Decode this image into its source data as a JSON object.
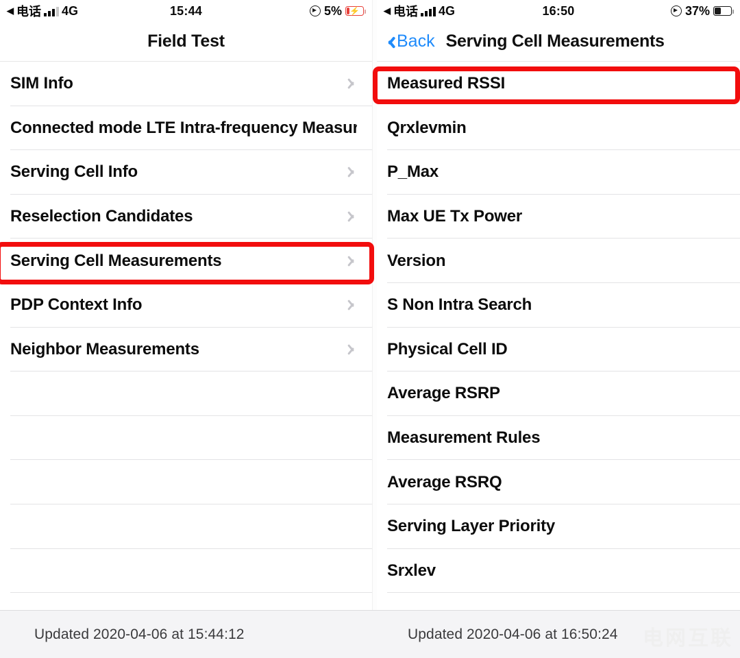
{
  "left_panel": {
    "status_bar": {
      "back_arrow": "◀",
      "carrier": "电话",
      "signal_icon": "signal-bars-icon",
      "network": "4G",
      "time": "15:44",
      "location_icon": "location-arrow-icon",
      "battery_percent": "5%",
      "battery_icon": "battery-low-charging-icon",
      "battery_level": 5,
      "charging": true
    },
    "nav": {
      "title": "Field Test"
    },
    "rows": [
      {
        "label": "SIM Info",
        "chevron": true
      },
      {
        "label": "Connected mode LTE Intra-frequency Measuremen",
        "chevron": false
      },
      {
        "label": "Serving Cell Info",
        "chevron": true
      },
      {
        "label": "Reselection Candidates",
        "chevron": true
      },
      {
        "label": "Serving Cell Measurements",
        "chevron": true,
        "highlighted": true
      },
      {
        "label": "PDP Context Info",
        "chevron": true
      },
      {
        "label": "Neighbor Measurements",
        "chevron": true
      },
      {
        "label": "",
        "chevron": false
      },
      {
        "label": "",
        "chevron": false
      },
      {
        "label": "",
        "chevron": false
      },
      {
        "label": "",
        "chevron": false
      },
      {
        "label": "",
        "chevron": false
      }
    ],
    "footer": {
      "updated": "Updated 2020-04-06 at 15:44:12"
    }
  },
  "right_panel": {
    "status_bar": {
      "back_arrow": "◀",
      "carrier": "电话",
      "signal_icon": "signal-bars-icon",
      "network": "4G",
      "time": "16:50",
      "location_icon": "location-arrow-icon",
      "battery_percent": "37%",
      "battery_icon": "battery-icon",
      "battery_level": 37,
      "charging": false
    },
    "nav": {
      "back_label": "Back",
      "title": "Serving Cell Measurements"
    },
    "rows": [
      {
        "label": "Measured RSSI",
        "highlighted": true
      },
      {
        "label": "Qrxlevmin"
      },
      {
        "label": "P_Max"
      },
      {
        "label": "Max UE Tx Power"
      },
      {
        "label": "Version"
      },
      {
        "label": "S Non Intra Search"
      },
      {
        "label": "Physical Cell ID"
      },
      {
        "label": "Average RSRP"
      },
      {
        "label": "Measurement Rules"
      },
      {
        "label": "Average RSRQ"
      },
      {
        "label": "Serving Layer Priority"
      },
      {
        "label": "Srxlev"
      }
    ],
    "footer": {
      "updated": "Updated 2020-04-06 at 16:50:24"
    }
  },
  "watermark": {
    "text": "电网互联"
  },
  "colors": {
    "highlight_red": "#f20d0d",
    "ios_blue": "#1f8bfb",
    "battery_red": "#e8403a",
    "separator": "#e3e3e5",
    "footer_bg": "#f4f4f6",
    "chevron_gray": "#c6c6cb"
  }
}
